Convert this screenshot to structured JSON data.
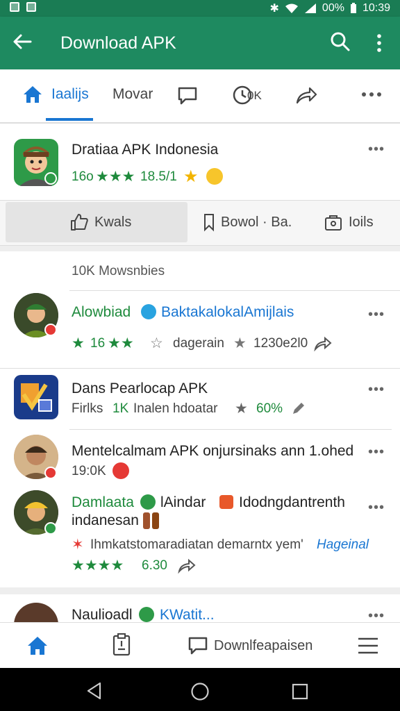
{
  "status": {
    "battery": "00%",
    "time": "10:39"
  },
  "appbar": {
    "title": "Download APK"
  },
  "tabs": [
    {
      "label": "Iaalijs"
    },
    {
      "label": "Movar"
    },
    {
      "label": "0K"
    }
  ],
  "app": {
    "name": "Dratiaa APK Indonesia",
    "rating_text": "16o",
    "reviews": "18.5/1",
    "actions": [
      "Kwals",
      "Bowol · Ba.",
      "Ioils"
    ]
  },
  "feed": {
    "header": "10K Mowsnbies",
    "items": [
      {
        "name": "Alowbiad",
        "tag": "BaktakalokalAmijlais",
        "stat1": "16",
        "stat2": "dagerain",
        "stat3": "1230e2l0"
      },
      {
        "name": "Dans Pearlocap APK",
        "sub1": "Firlks",
        "sub2": "1K",
        "sub3": "Inalen hdoatar",
        "percent": "60%"
      },
      {
        "name": "Mentelcalmam APK onjursinaks ann 1.ohed",
        "count": "19:0K"
      },
      {
        "name": "Damlaata",
        "tag1": "lAindar",
        "tag2": "Idodngdantrenth",
        "line2": "indanesan",
        "line3": "Ihmkatstomaradiatan demarntx yem'",
        "highlight": "Hageinal",
        "score": "6.30"
      },
      {
        "name": "Naulioadl",
        "tag": "KWatit..."
      }
    ]
  },
  "bottomnav": {
    "label": "Downlfeapaisen"
  },
  "colors": {
    "primary": "#1e8a60",
    "accent": "#1976d2",
    "star": "#1e8a3c"
  }
}
